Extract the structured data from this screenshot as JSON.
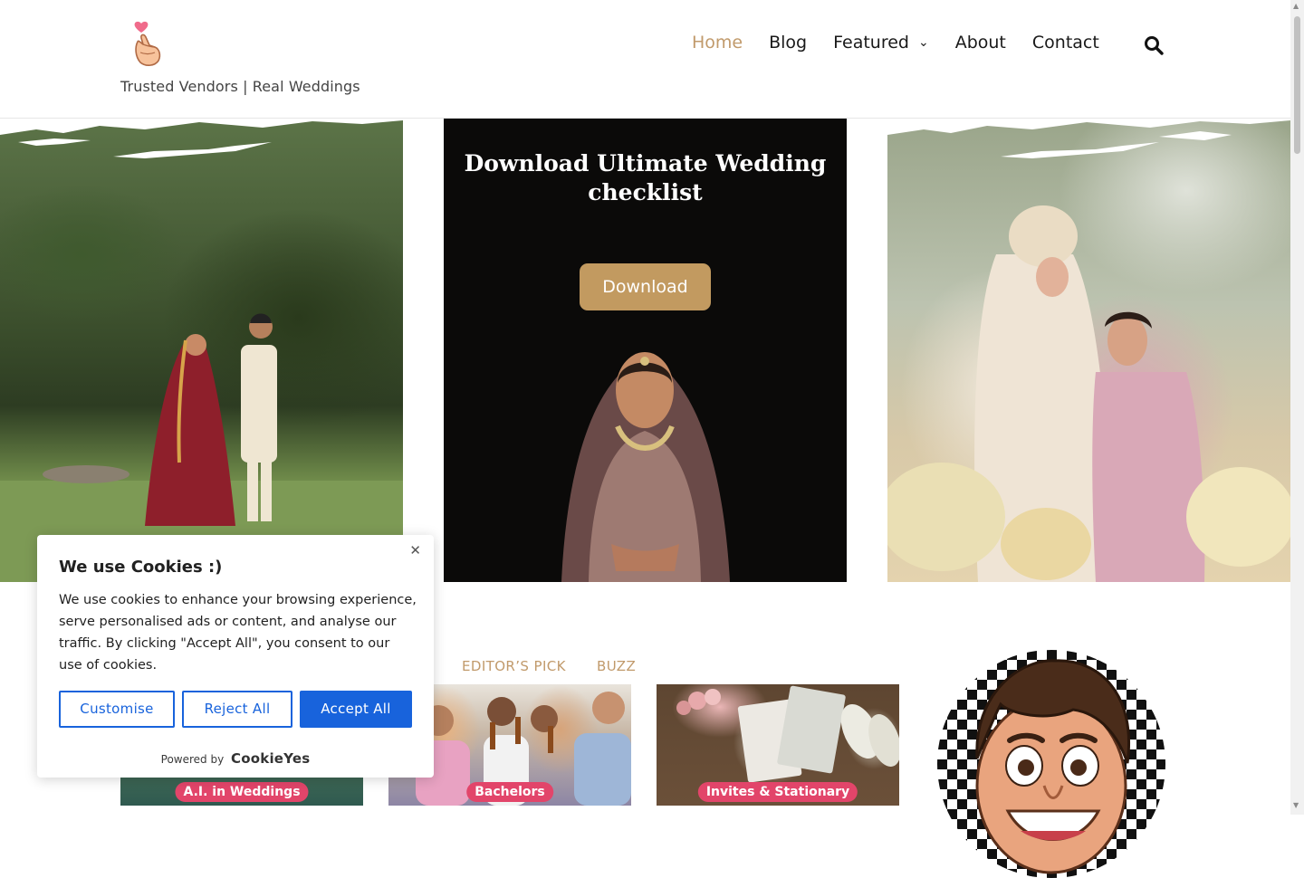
{
  "header": {
    "tagline": "Trusted Vendors | Real Weddings",
    "logo_icon": "finger-heart-icon"
  },
  "nav": {
    "items": [
      {
        "label": "Home",
        "active": true
      },
      {
        "label": "Blog"
      },
      {
        "label": "Featured",
        "has_dropdown": true
      },
      {
        "label": "About"
      },
      {
        "label": "Contact"
      }
    ],
    "search_icon": "search-icon",
    "active_color": "#c19a6b"
  },
  "hero": {
    "promo_title": "Download Ultimate Wedding checklist",
    "download_label": "Download",
    "button_color": "#c29a60"
  },
  "tabs": [
    "EDITOR’S PICK",
    "BUZZ"
  ],
  "cards": [
    {
      "badge": "A.I. in Weddings"
    },
    {
      "badge": "Bachelors"
    },
    {
      "badge": "Invites & Stationary"
    }
  ],
  "cookie": {
    "title": "We use Cookies :)",
    "body": "We use cookies to enhance your browsing experience, serve personalised ads or content, and analyse our traffic. By clicking \"Accept All\", you consent to our use of cookies.",
    "customise": "Customise",
    "reject": "Reject All",
    "accept": "Accept All",
    "powered_by": "Powered by",
    "brand": "CookieYes",
    "accent": "#1863dc"
  }
}
